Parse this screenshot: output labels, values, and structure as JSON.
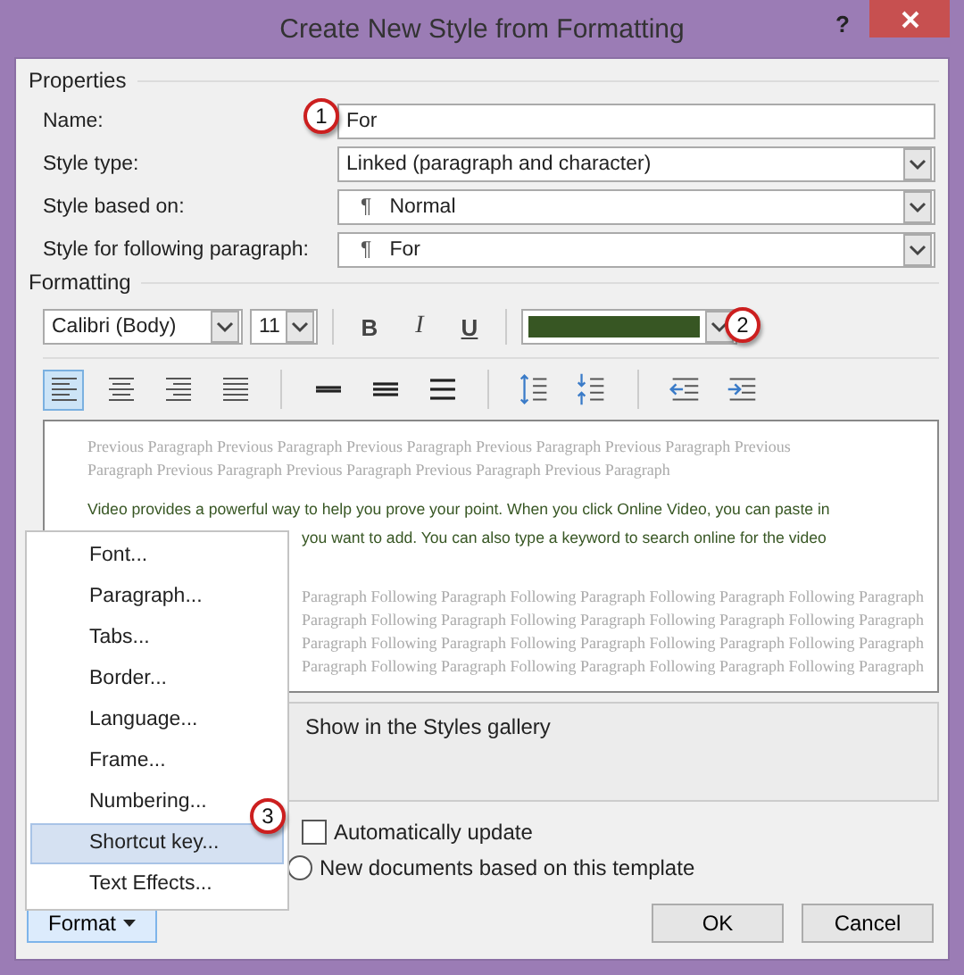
{
  "window": {
    "title": "Create New Style from Formatting",
    "help": "?"
  },
  "properties": {
    "heading": "Properties",
    "callout": "1",
    "fields": [
      {
        "kind": "text",
        "label": "Name:",
        "value": "For"
      },
      {
        "kind": "select",
        "label": "Style type:",
        "value": "Linked (paragraph and character)"
      },
      {
        "kind": "select",
        "label": "Style based on:",
        "mark": "¶",
        "value": "Normal"
      },
      {
        "kind": "select",
        "label": "Style for following paragraph:",
        "mark": "¶",
        "value": "For"
      }
    ]
  },
  "formatting": {
    "heading": "Formatting",
    "callout": "2",
    "font": "Calibri (Body)",
    "size": "11",
    "styles": [
      "B",
      "I",
      "U"
    ],
    "font_color": {
      "color": "#375623"
    },
    "tools": [
      {
        "kind": "align-left",
        "selected": true
      },
      {
        "kind": "align-center",
        "selected": false
      },
      {
        "kind": "align-right",
        "selected": false
      },
      {
        "kind": "justify",
        "selected": false
      },
      {
        "kind": "single-spacing",
        "selected": false
      },
      {
        "kind": "one-half-spacing",
        "selected": false
      },
      {
        "kind": "double-spacing",
        "selected": false
      },
      {
        "kind": "increase-spacing",
        "selected": false
      },
      {
        "kind": "decrease-spacing",
        "selected": false
      },
      {
        "kind": "decrease-indent",
        "selected": false
      },
      {
        "kind": "increase-indent",
        "selected": false
      }
    ]
  },
  "preview": {
    "previous": [
      "Previous Paragraph Previous Paragraph Previous Paragraph Previous Paragraph Previous Paragraph Previous",
      "Paragraph Previous Paragraph Previous Paragraph Previous Paragraph Previous Paragraph"
    ],
    "sample": [
      "Video provides a powerful way to help you prove your point. When you click Online Video, you can paste in",
      "you want to add. You can also type a keyword to search online for the video"
    ],
    "following": [
      "Paragraph Following Paragraph Following Paragraph Following Paragraph Following Paragraph",
      "Paragraph Following Paragraph Following Paragraph Following Paragraph Following Paragraph",
      "Paragraph Following Paragraph Following Paragraph Following Paragraph Following Paragraph",
      "Paragraph Following Paragraph Following Paragraph Following Paragraph Following Paragraph"
    ]
  },
  "description": "Show in the Styles gallery",
  "options": [
    {
      "kind": "checkbox",
      "label": "Automatically update",
      "checked": false
    },
    {
      "kind": "radio",
      "label": "New documents based on this template",
      "selected": false
    }
  ],
  "menu": {
    "callout": "3",
    "items": [
      {
        "label": "Font...",
        "selected": false
      },
      {
        "label": "Paragraph...",
        "selected": false
      },
      {
        "label": "Tabs...",
        "selected": false
      },
      {
        "label": "Border...",
        "selected": false
      },
      {
        "label": "Language...",
        "selected": false
      },
      {
        "label": "Frame...",
        "selected": false
      },
      {
        "label": "Numbering...",
        "selected": false
      },
      {
        "label": "Shortcut key...",
        "selected": true
      },
      {
        "label": "Text Effects...",
        "selected": false
      }
    ]
  },
  "buttons": {
    "format": "Format",
    "ok": "OK",
    "cancel": "Cancel"
  }
}
